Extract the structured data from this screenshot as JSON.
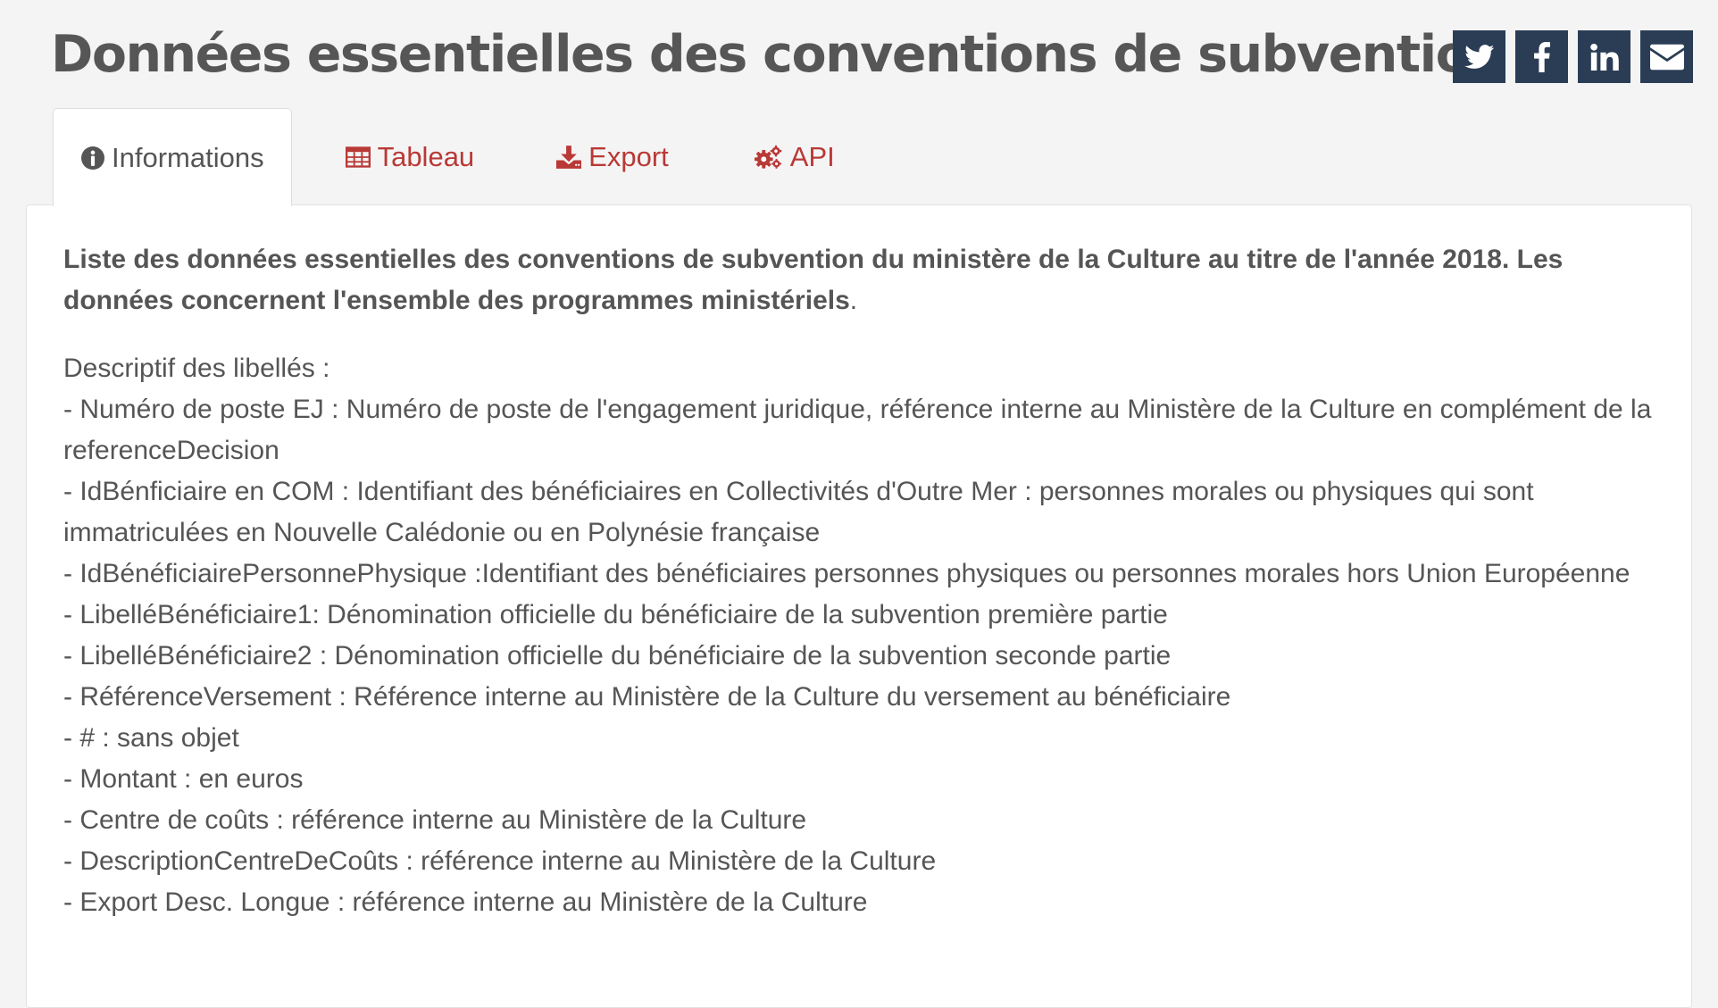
{
  "page": {
    "title": "Données essentielles des conventions de subvention"
  },
  "share": [
    {
      "icon": "twitter-icon",
      "label": "Twitter"
    },
    {
      "icon": "facebook-icon",
      "label": "Facebook"
    },
    {
      "icon": "linkedin-icon",
      "label": "LinkedIn"
    },
    {
      "icon": "email-icon",
      "label": "Email"
    }
  ],
  "tabs": [
    {
      "label": "Informations",
      "icon": "info-circle-icon",
      "active": true
    },
    {
      "label": "Tableau",
      "icon": "table-icon",
      "active": false
    },
    {
      "label": "Export",
      "icon": "download-icon",
      "active": false
    },
    {
      "label": "API",
      "icon": "cogs-icon",
      "active": false
    }
  ],
  "content": {
    "intro_bold": "Liste des données essentielles des conventions de subvention du ministère de la Culture au titre de l'année 2018. Les données concernent l'ensemble des programmes ministériels",
    "intro_tail": ".",
    "description_lines": [
      "Descriptif des libellés :",
      "- Numéro de poste EJ : Numéro de poste de l'engagement juridique, référence interne au Ministère de la Culture en complément de la referenceDecision",
      "- IdBénficiaire en COM : Identifiant des bénéficiaires en Collectivités d'Outre Mer : personnes morales ou physiques qui sont immatriculées en Nouvelle Calédonie ou en Polynésie française",
      "- IdBénéficiairePersonnePhysique :Identifiant des bénéficiaires personnes physiques ou personnes morales hors Union Européenne",
      "- LibelléBénéficiaire1: Dénomination officielle du bénéficiaire de la subvention première partie",
      "- LibelléBénéficiaire2 : Dénomination officielle du bénéficiaire de la subvention seconde partie",
      "- RéférenceVersement : Référence interne au Ministère de la Culture du versement au bénéficiaire",
      "- # : sans objet",
      "- Montant : en euros",
      "- Centre de coûts : référence interne au Ministère de la Culture",
      "- DescriptionCentreDeCoûts : référence interne au Ministère de la Culture",
      "- Export Desc. Longue : référence interne au Ministère de la Culture"
    ]
  },
  "colors": {
    "tab_accent": "#b93936",
    "share_bg": "#2a3d55",
    "page_bg": "#f4f4f4"
  }
}
